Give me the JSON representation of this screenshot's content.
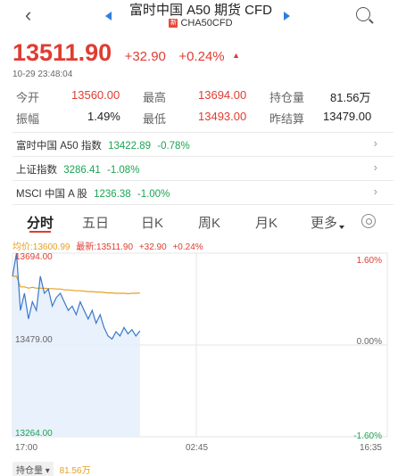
{
  "header": {
    "back_icon": "chevron-left-icon",
    "title": "富时中国 A50 期货 CFD",
    "subtitle": "CHA50CFD",
    "flag_text": "新",
    "search_icon": "search-icon"
  },
  "quote": {
    "price": "13511.90",
    "change": "+32.90",
    "change_pct": "+0.24%",
    "time": "10-29 23:48:04",
    "up_color": "#e03c31",
    "down_color": "#1aa552"
  },
  "stats": {
    "open_label": "今开",
    "open_value": "13560.00",
    "high_label": "最高",
    "high_value": "13694.00",
    "oi_label": "持仓量",
    "oi_value": "81.56万",
    "amp_label": "振幅",
    "amp_value": "1.49%",
    "low_label": "最低",
    "low_value": "13493.00",
    "prev_label": "昨结算",
    "prev_value": "13479.00"
  },
  "indices": [
    {
      "name": "富时中国 A50 指数",
      "value": "13422.89",
      "change": "-0.78%"
    },
    {
      "name": "上证指数",
      "value": "3286.41",
      "change": "-1.08%"
    },
    {
      "name": "MSCI 中国 A 股",
      "value": "1236.38",
      "change": "-1.00%"
    }
  ],
  "tabs": [
    "分时",
    "五日",
    "日K",
    "周K",
    "月K",
    "更多"
  ],
  "legend": {
    "avg_label": "均价:13600.99",
    "last_label": "最新:13511.90",
    "last_change": "+32.90",
    "last_pct": "+0.24%"
  },
  "chart_data": {
    "type": "line",
    "y_left_ticks": [
      "13694.00",
      "13479.00",
      "13264.00"
    ],
    "y_right_ticks": [
      "1.60%",
      "0.00%",
      "-1.60%"
    ],
    "x_ticks": [
      "17:00",
      "02:45",
      "16:35"
    ],
    "ylim": [
      13264,
      13694
    ],
    "series": [
      {
        "values": [
          13640,
          13694,
          13560,
          13600,
          13540,
          13580,
          13560,
          13640,
          13600,
          13610,
          13570,
          13590,
          13600,
          13580,
          13560,
          13570,
          13550,
          13580,
          13560,
          13540,
          13560,
          13530,
          13550,
          13520,
          13500,
          13493,
          13510,
          13500,
          13520,
          13505,
          13515,
          13500,
          13512
        ]
      },
      {
        "values": [
          13640,
          13640,
          13615,
          13615,
          13612,
          13614,
          13612,
          13612,
          13612,
          13611,
          13611,
          13610,
          13610,
          13608,
          13608,
          13607,
          13606,
          13606,
          13605,
          13604,
          13604,
          13603,
          13603,
          13602,
          13601,
          13601,
          13600,
          13600,
          13600,
          13599,
          13600,
          13600,
          13601
        ]
      }
    ],
    "line_color": "#3a78c9",
    "avg_color": "#e6a023"
  },
  "footer": {
    "label": "持仓量",
    "value": "81.56万"
  }
}
